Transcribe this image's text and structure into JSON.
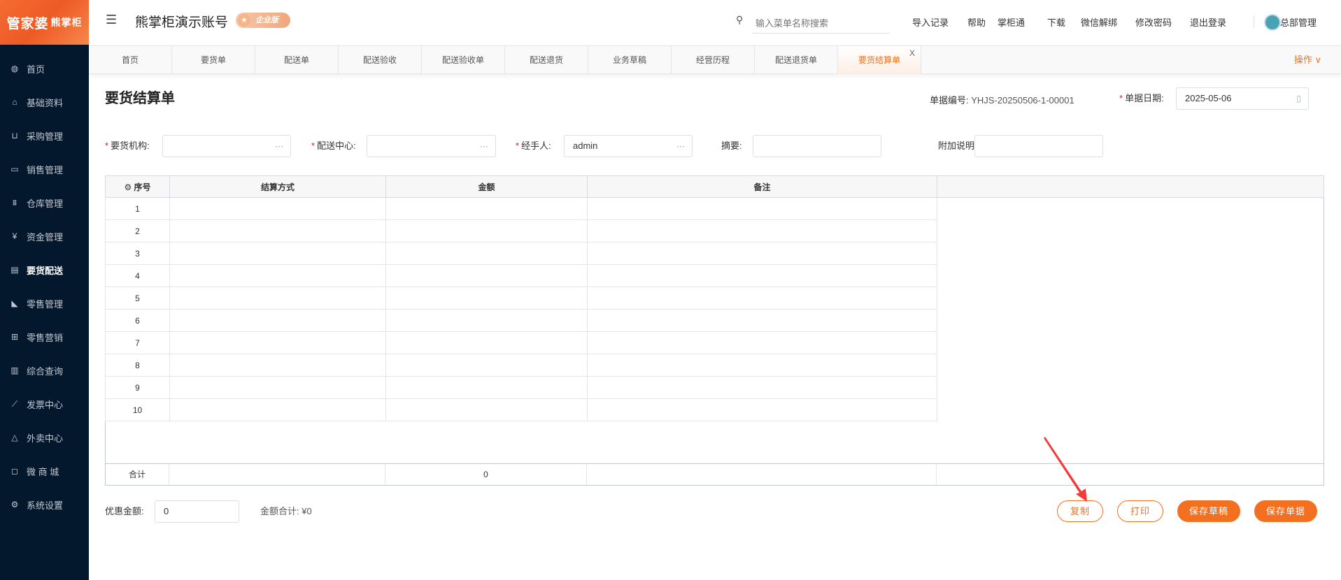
{
  "logo": {
    "text": "管家婆",
    "sub": "熊掌柜"
  },
  "sidebar": {
    "items": [
      {
        "label": "首页",
        "icon": "globe-icon",
        "glyph": "◍"
      },
      {
        "label": "基础资料",
        "icon": "home-icon",
        "glyph": "⌂"
      },
      {
        "label": "采购管理",
        "icon": "cart-icon",
        "glyph": "⊔"
      },
      {
        "label": "销售管理",
        "icon": "calendar-icon",
        "glyph": "▭"
      },
      {
        "label": "仓库管理",
        "icon": "bank-icon",
        "glyph": "⩩"
      },
      {
        "label": "资金管理",
        "icon": "money-icon",
        "glyph": "¥"
      },
      {
        "label": "要货配送",
        "icon": "list-icon",
        "glyph": "▤"
      },
      {
        "label": "零售管理",
        "icon": "area-chart-icon",
        "glyph": "◣"
      },
      {
        "label": "零售营销",
        "icon": "gift-icon",
        "glyph": "⊞"
      },
      {
        "label": "综合查询",
        "icon": "bar-chart-icon",
        "glyph": "▥"
      },
      {
        "label": "发票中心",
        "icon": "line-chart-icon",
        "glyph": "⟋"
      },
      {
        "label": "外卖中心",
        "icon": "alarm-icon",
        "glyph": "△"
      },
      {
        "label": "微 商 城",
        "icon": "bag-icon",
        "glyph": "◻"
      },
      {
        "label": "系统设置",
        "icon": "gear-icon",
        "glyph": "⚙"
      }
    ],
    "active": "要货配送"
  },
  "header": {
    "title": "熊掌柜演示账号",
    "badge": "企业版",
    "search_placeholder": "输入菜单名称搜索",
    "links": [
      "导入记录",
      "帮助",
      "掌柜通",
      "下载",
      "微信解绑",
      "修改密码",
      "退出登录"
    ],
    "user": "总部管理"
  },
  "tabs": {
    "items": [
      "首页",
      "要货单",
      "配送单",
      "配送验收",
      "配送验收单",
      "配送退货",
      "业务草稿",
      "经营历程",
      "配送退货单",
      "要货结算单"
    ],
    "active": "要货结算单",
    "close": "X",
    "ops": "操作"
  },
  "page": {
    "title": "要货结算单",
    "doc_no_label": "单据编号:",
    "doc_no": "YHJS-20250506-1-00001",
    "date_label": "单据日期:",
    "date": "2025-05-06"
  },
  "form": {
    "org_label": "要货机构:",
    "org": "",
    "center_label": "配送中心:",
    "center": "",
    "handler_label": "经手人:",
    "handler": "admin",
    "summary_label": "摘要:",
    "summary": "",
    "note_label": "附加说明:",
    "note": "",
    "more": "···"
  },
  "table": {
    "columns": [
      "序号",
      "结算方式",
      "金额",
      "备注"
    ],
    "rows": [
      "1",
      "2",
      "3",
      "4",
      "5",
      "6",
      "7",
      "8",
      "9",
      "10"
    ],
    "total_label": "合计",
    "total_amount": "0"
  },
  "footer": {
    "discount_label": "优惠金额:",
    "discount": "0",
    "sum_label": "金额合计:",
    "sum": "¥0"
  },
  "buttons": {
    "copy": "复制",
    "print": "打印",
    "save_draft": "保存草稿",
    "save": "保存单据"
  },
  "colors": {
    "accent": "#f37021",
    "sidebar": "#03172d",
    "annotation": "#f03c3c"
  }
}
